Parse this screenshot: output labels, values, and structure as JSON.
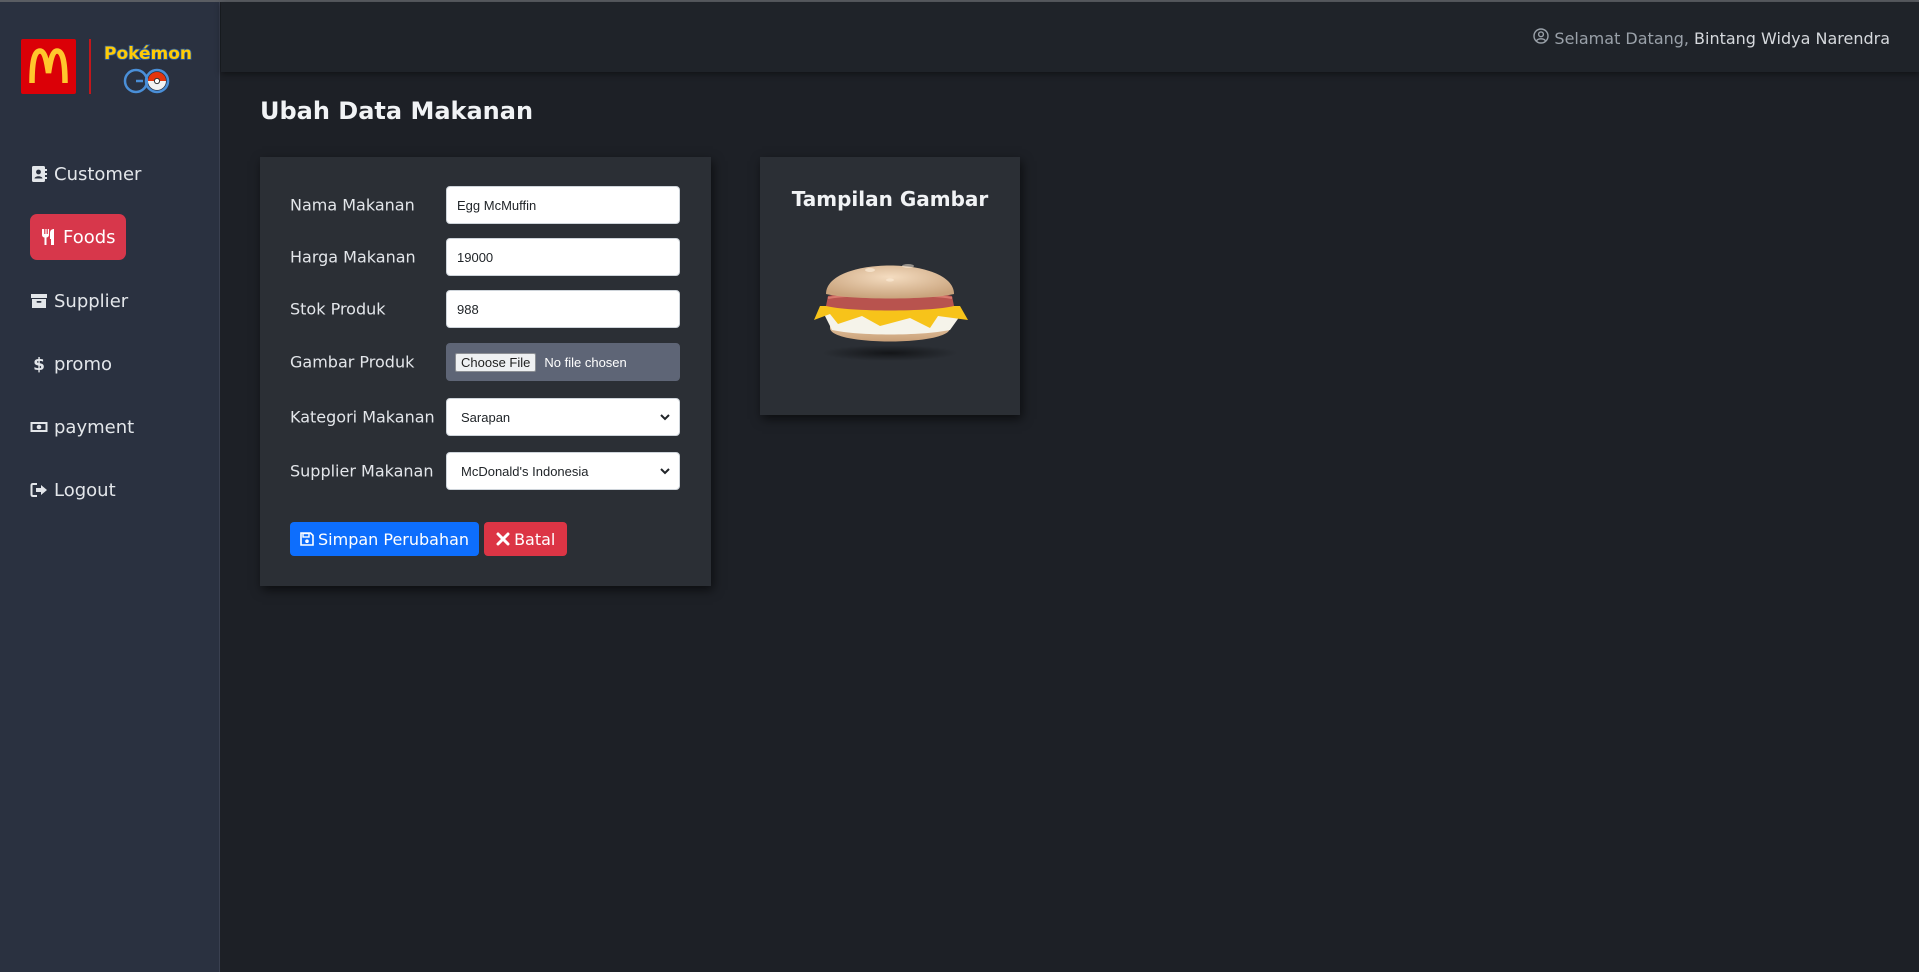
{
  "header": {
    "welcome_prefix": "Selamat Datang,",
    "user_name": "Bintang Widya Narendra",
    "user_icon": "user-circle-icon"
  },
  "brand": {
    "logos": [
      "mcdonalds-logo",
      "pokemon-go-logo"
    ],
    "logo_lettering": [
      "Pokémon",
      "GO"
    ]
  },
  "sidebar": {
    "items": [
      {
        "label": "Customer",
        "icon": "address-book-icon",
        "active": false
      },
      {
        "label": "Foods",
        "icon": "utensils-icon",
        "active": true
      },
      {
        "label": "Supplier",
        "icon": "archive-icon",
        "active": false
      },
      {
        "label": "promo",
        "icon": "dollar-icon",
        "active": false
      },
      {
        "label": "payment",
        "icon": "money-icon",
        "active": false
      },
      {
        "label": "Logout",
        "icon": "sign-out-icon",
        "active": false
      }
    ]
  },
  "page": {
    "title": "Ubah Data Makanan"
  },
  "form": {
    "nama": {
      "label": "Nama Makanan",
      "value": "Egg McMuffin"
    },
    "harga": {
      "label": "Harga Makanan",
      "value": "19000"
    },
    "stok": {
      "label": "Stok Produk",
      "value": "988"
    },
    "gambar": {
      "label": "Gambar Produk",
      "button": "Choose File",
      "status": "No file chosen"
    },
    "kategori": {
      "label": "Kategori Makanan",
      "value": "Sarapan"
    },
    "supplier": {
      "label": "Supplier Makanan",
      "value": "McDonald's Indonesia"
    },
    "save_label": "Simpan Perubahan",
    "cancel_label": "Batal"
  },
  "preview": {
    "title": "Tampilan Gambar",
    "image": "egg-mcmuffin-burger"
  },
  "colors": {
    "sidebar_bg": "#2a3140",
    "content_bg": "#1d2026",
    "card_bg": "#2b2f35",
    "active_nav": "#d7374b",
    "primary": "#0d6efd",
    "danger": "#dc3545",
    "mcd_red": "#db0007",
    "mcd_yellow": "#ffc72c"
  }
}
